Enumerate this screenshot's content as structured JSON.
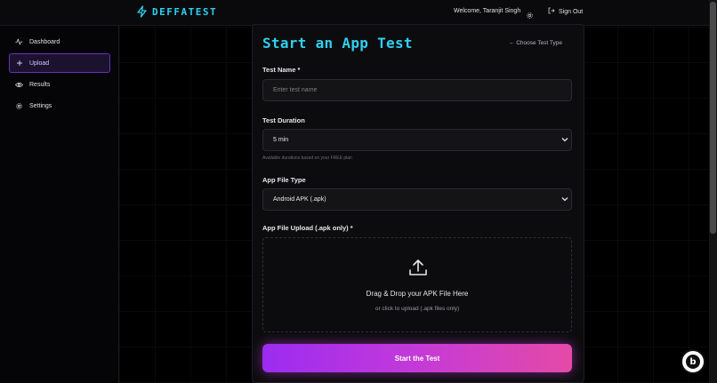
{
  "header": {
    "logo_text": "DEFFATEST",
    "welcome": "Welcome, Taranjit Singh",
    "signout_label": "Sign Out"
  },
  "sidebar": {
    "items": [
      {
        "label": "Dashboard",
        "icon": "activity-icon",
        "active": false
      },
      {
        "label": "Upload",
        "icon": "plus-icon",
        "active": true
      },
      {
        "label": "Results",
        "icon": "eye-icon",
        "active": false
      },
      {
        "label": "Settings",
        "icon": "gear-icon",
        "active": false
      }
    ]
  },
  "form": {
    "title": "Start an App Test",
    "back_link": "← Choose Test Type",
    "test_name": {
      "label": "Test Name *",
      "placeholder": "Enter test name",
      "value": ""
    },
    "test_duration": {
      "label": "Test Duration",
      "value": "5 min",
      "hint": "Available durations based on your FREE plan"
    },
    "file_type": {
      "label": "App File Type",
      "value": "Android APK (.apk)"
    },
    "file_upload": {
      "label": "App File Upload (.apk only) *",
      "drop_title": "Drag & Drop your APK File Here",
      "drop_subtitle": "or click to upload (.apk files only)"
    },
    "submit_label": "Start the Test"
  },
  "badge": {
    "letter": "b"
  },
  "colors": {
    "accent_cyan": "#2fd0f0",
    "accent_purple": "#9b2cf0",
    "accent_pink": "#e44aa6",
    "background": "#000000"
  }
}
